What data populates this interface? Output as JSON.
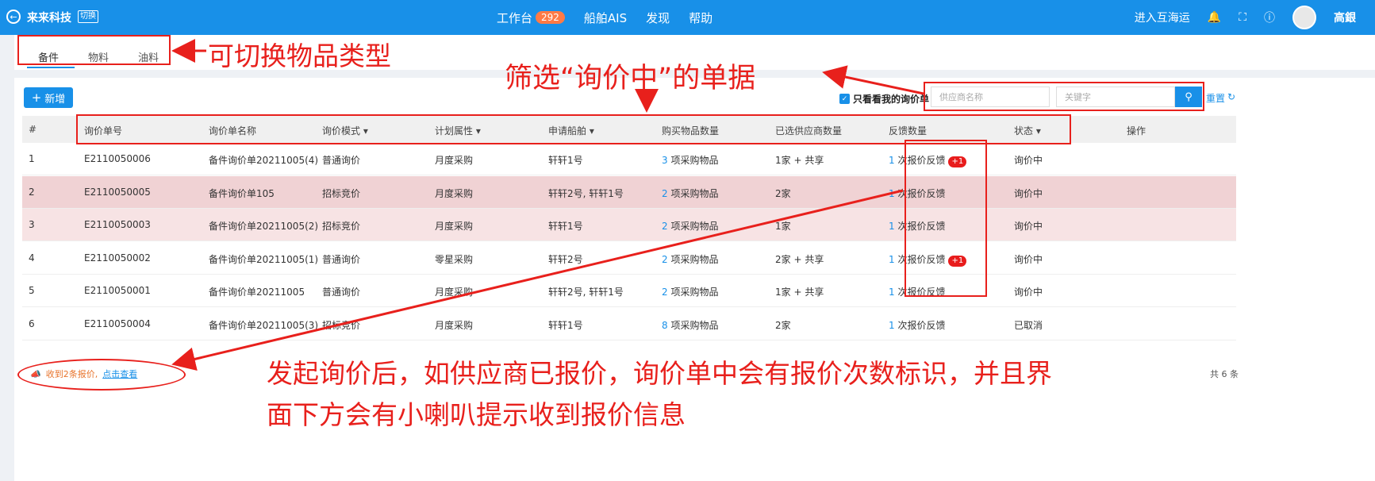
{
  "topbar": {
    "brand": "来来科技",
    "switch_tag": "切换",
    "nav": [
      {
        "label": "工作台",
        "badge": "292"
      },
      {
        "label": "船舶AIS"
      },
      {
        "label": "发现"
      },
      {
        "label": "帮助"
      }
    ],
    "right_link": "进入互海运",
    "user_name": "高銀"
  },
  "tabs": [
    "备件",
    "物料",
    "油料"
  ],
  "toolbar": {
    "add_label": "新增",
    "only_mine_label": "只看看我的询价单",
    "supplier_placeholder": "供应商名称",
    "keyword_placeholder": "关键字",
    "reset_label": "重置"
  },
  "table": {
    "headers": [
      "#",
      "询价单号",
      "询价单名称",
      "询价模式",
      "计划属性",
      "申请船舶",
      "购买物品数量",
      "已选供应商数量",
      "反馈数量",
      "状态",
      "操作"
    ],
    "rows": [
      {
        "idx": "1",
        "no": "E2110050006",
        "name": "备件询价单20211005(4)",
        "mode": "普通询价",
        "plan": "月度采购",
        "ship": "轩轩1号",
        "qty_num": "3",
        "qty_text": " 项采购物品",
        "sup_num": "1家",
        "sup_share": " + 共享",
        "fb_num": "1",
        "fb_text": " 次报价反馈",
        "fb_badge": "+1",
        "status": "询价中"
      },
      {
        "idx": "2",
        "no": "E2110050005",
        "name": "备件询价单105",
        "mode": "招标竞价",
        "plan": "月度采购",
        "ship": "轩轩2号, 轩轩1号",
        "qty_num": "2",
        "qty_text": " 项采购物品",
        "sup_num": "2家",
        "sup_share": "",
        "fb_num": "1",
        "fb_text": " 次报价反馈",
        "fb_badge": "",
        "status": "询价中"
      },
      {
        "idx": "3",
        "no": "E2110050003",
        "name": "备件询价单20211005(2)",
        "mode": "招标竞价",
        "plan": "月度采购",
        "ship": "轩轩1号",
        "qty_num": "2",
        "qty_text": " 项采购物品",
        "sup_num": "1家",
        "sup_share": "",
        "fb_num": "1",
        "fb_text": " 次报价反馈",
        "fb_badge": "",
        "status": "询价中"
      },
      {
        "idx": "4",
        "no": "E2110050002",
        "name": "备件询价单20211005(1)",
        "mode": "普通询价",
        "plan": "零星采购",
        "ship": "轩轩2号",
        "qty_num": "2",
        "qty_text": " 项采购物品",
        "sup_num": "2家",
        "sup_share": " + 共享",
        "fb_num": "1",
        "fb_text": " 次报价反馈",
        "fb_badge": "+1",
        "status": "询价中"
      },
      {
        "idx": "5",
        "no": "E2110050001",
        "name": "备件询价单20211005",
        "mode": "普通询价",
        "plan": "月度采购",
        "ship": "轩轩2号, 轩轩1号",
        "qty_num": "2",
        "qty_text": " 项采购物品",
        "sup_num": "1家",
        "sup_share": " + 共享",
        "fb_num": "1",
        "fb_text": " 次报价反馈",
        "fb_badge": "",
        "status": "询价中"
      },
      {
        "idx": "6",
        "no": "E2110050004",
        "name": "备件询价单20211005(3)",
        "mode": "招标竞价",
        "plan": "月度采购",
        "ship": "轩轩1号",
        "qty_num": "8",
        "qty_text": " 项采购物品",
        "sup_num": "2家",
        "sup_share": "",
        "fb_num": "1",
        "fb_text": " 次报价反馈",
        "fb_badge": "",
        "status": "已取消"
      }
    ]
  },
  "notification": {
    "text": "收到2条报价,",
    "link": "点击查看"
  },
  "total": "共 6 条",
  "annotations": {
    "tabs_note": "可切换物品类型",
    "filter_note": "筛选“询价中”的单据",
    "bottom_note_line1": "发起询价后，如供应商已报价，询价单中会有报价次数标识，并且界",
    "bottom_note_line2": "面下方会有小喇叭提示收到报价信息"
  },
  "colors": {
    "accent": "#1890e8",
    "annotation": "#e8201c",
    "row_highlight": "#f0d2d4"
  }
}
